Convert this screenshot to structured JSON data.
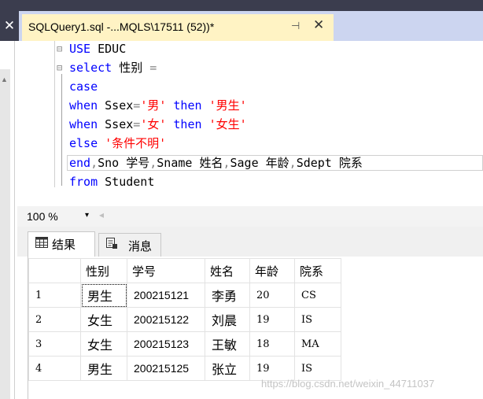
{
  "tab": {
    "title": "SQLQuery1.sql -...MQLS\\17511 (52))*",
    "pin_glyph": "⊣",
    "close_glyph": "✕",
    "left_close_glyph": "✕"
  },
  "editor": {
    "lines": [
      [
        {
          "t": "USE",
          "c": "kw"
        },
        {
          "t": " EDUC",
          "c": "plain"
        }
      ],
      [
        {
          "t": "select",
          "c": "kw"
        },
        {
          "t": " 性别 ",
          "c": "plain"
        },
        {
          "t": "=",
          "c": "gray"
        }
      ],
      [
        {
          "t": "case",
          "c": "kw"
        }
      ],
      [
        {
          "t": "when",
          "c": "kw"
        },
        {
          "t": " Ssex",
          "c": "plain"
        },
        {
          "t": "=",
          "c": "gray"
        },
        {
          "t": "'男'",
          "c": "str"
        },
        {
          "t": " then ",
          "c": "kw"
        },
        {
          "t": "'男生'",
          "c": "str"
        }
      ],
      [
        {
          "t": "when",
          "c": "kw"
        },
        {
          "t": " Ssex",
          "c": "plain"
        },
        {
          "t": "=",
          "c": "gray"
        },
        {
          "t": "'女'",
          "c": "str"
        },
        {
          "t": " then ",
          "c": "kw"
        },
        {
          "t": "'女生'",
          "c": "str"
        }
      ],
      [
        {
          "t": "else",
          "c": "kw"
        },
        {
          "t": " '条件不明'",
          "c": "str"
        }
      ],
      [
        {
          "t": "end",
          "c": "kw"
        },
        {
          "t": ",",
          "c": "gray"
        },
        {
          "t": "Sno 学号",
          "c": "plain"
        },
        {
          "t": ",",
          "c": "gray"
        },
        {
          "t": "Sname 姓名",
          "c": "plain"
        },
        {
          "t": ",",
          "c": "gray"
        },
        {
          "t": "Sage 年龄",
          "c": "plain"
        },
        {
          "t": ",",
          "c": "gray"
        },
        {
          "t": "Sdept 院系",
          "c": "plain"
        }
      ],
      [
        {
          "t": "from",
          "c": "kw"
        },
        {
          "t": " Student",
          "c": "plain"
        }
      ]
    ]
  },
  "zoom": {
    "value": "100 %",
    "dropdown_glyph": "▾",
    "scroll_glyph": "◂"
  },
  "result_tabs": {
    "results": "结果",
    "messages": "消息"
  },
  "results": {
    "columns": [
      "性别",
      "学号",
      "姓名",
      "年龄",
      "院系"
    ],
    "rows": [
      {
        "n": "1",
        "cells": [
          "男生",
          "200215121",
          "李勇",
          "20",
          "CS"
        ]
      },
      {
        "n": "2",
        "cells": [
          "女生",
          "200215122",
          "刘晨",
          "19",
          "IS"
        ]
      },
      {
        "n": "3",
        "cells": [
          "女生",
          "200215123",
          "王敏",
          "18",
          "MA"
        ]
      },
      {
        "n": "4",
        "cells": [
          "男生",
          "200215125",
          "张立",
          "19",
          "IS"
        ]
      }
    ]
  },
  "watermark": "https://blog.csdn.net/weixin_44711037"
}
